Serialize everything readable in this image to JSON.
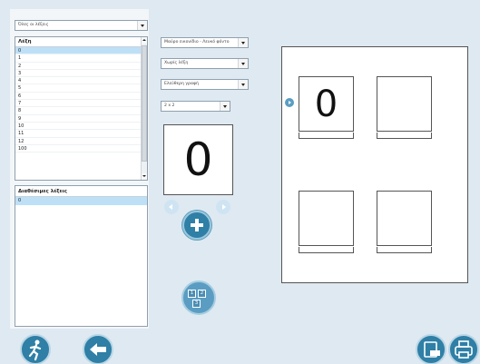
{
  "filter": {
    "all_words": "Όλες οι λέξεις"
  },
  "word_list": {
    "header": "Λέξη",
    "items": [
      "0",
      "1",
      "2",
      "3",
      "4",
      "5",
      "6",
      "7",
      "8",
      "9",
      "10",
      "11",
      "12",
      "100"
    ],
    "selected_index": 0
  },
  "available_words": {
    "header": "Διαθέσιμες λέξεις",
    "items": [
      "0"
    ]
  },
  "options": {
    "color_mode": "Μαύρο εικονίδιο - Λευκό φόντο",
    "word_mode": "Χωρίς λέξη",
    "font_mode": "Ελεύθερη γραφή",
    "grid_size": "2 x 2"
  },
  "preview": {
    "symbol": "0"
  },
  "sheet": {
    "cards": [
      "0",
      "",
      "",
      ""
    ]
  },
  "layout_button": {
    "cells": [
      "1",
      "2",
      "3"
    ]
  },
  "icons": {
    "exit": "exit-running-man-icon",
    "back": "back-arrow-icon",
    "pdf": "pdf-export-icon",
    "print": "printer-icon",
    "add": "plus-icon",
    "prev": "chevron-left-icon",
    "next": "chevron-right-icon",
    "pointer": "current-card-pointer-icon"
  },
  "colors": {
    "accent": "#2f7fa6",
    "selection": "#bde0f7",
    "background": "#dfe9f1"
  }
}
